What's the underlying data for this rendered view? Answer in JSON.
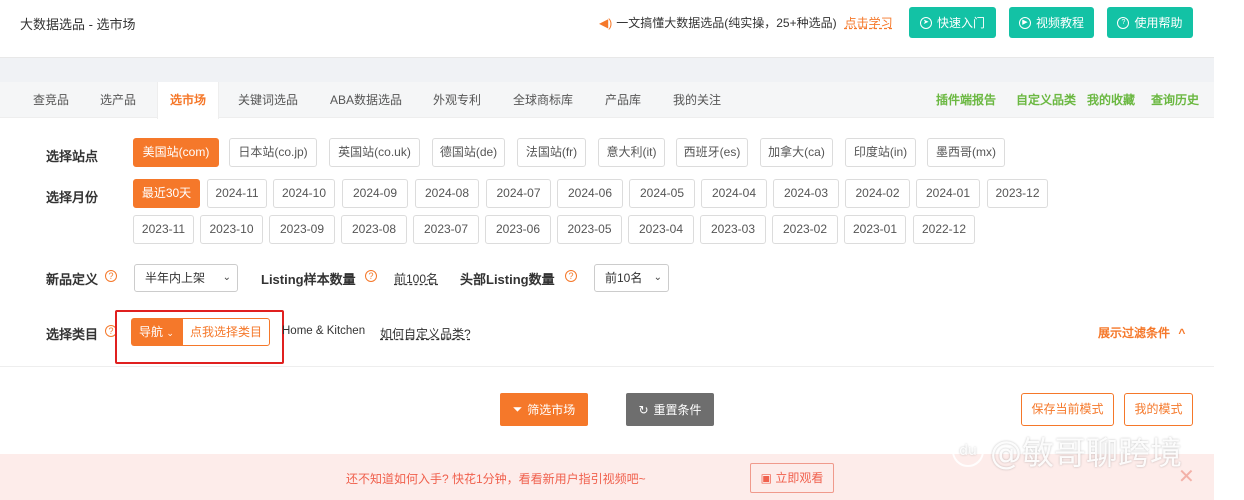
{
  "header": {
    "title": "大数据选品 - 选市场",
    "promo_text": "一文搞懂大数据选品(纯实操，25+种选品)",
    "promo_link": "点击学习",
    "buttons": [
      "快速入门",
      "视频教程",
      "使用帮助"
    ]
  },
  "tabs": [
    "查竞品",
    "选产品",
    "选市场",
    "关键词选品",
    "ABA数据选品",
    "外观专利",
    "全球商标库",
    "产品库",
    "我的关注"
  ],
  "active_tab": "选市场",
  "right_links": [
    "插件端报告",
    "自定义品类",
    "我的收藏",
    "查询历史"
  ],
  "site": {
    "label": "选择站点",
    "options": [
      "美国站(com)",
      "日本站(co.jp)",
      "英国站(co.uk)",
      "德国站(de)",
      "法国站(fr)",
      "意大利(it)",
      "西班牙(es)",
      "加拿大(ca)",
      "印度站(in)",
      "墨西哥(mx)"
    ],
    "selected": "美国站(com)"
  },
  "month": {
    "label": "选择月份",
    "row1": [
      "最近30天",
      "2024-11",
      "2024-10",
      "2024-09",
      "2024-08",
      "2024-07",
      "2024-06",
      "2024-05",
      "2024-04",
      "2024-03",
      "2024-02",
      "2024-01",
      "2023-12"
    ],
    "row2": [
      "2023-11",
      "2023-10",
      "2023-09",
      "2023-08",
      "2023-07",
      "2023-06",
      "2023-05",
      "2023-04",
      "2023-03",
      "2023-02",
      "2023-01",
      "2022-12"
    ],
    "selected": "最近30天"
  },
  "new_def": {
    "label": "新品定义",
    "value": "半年内上架",
    "listing_label": "Listing样本数量",
    "listing_value": "前100名",
    "top_label": "头部Listing数量",
    "top_value": "前10名"
  },
  "category": {
    "label": "选择类目",
    "nav_label": "导航",
    "pick_label": "点我选择类目",
    "current": "Home & Kitchen",
    "custom_link": "如何自定义品类?",
    "show_filter": "展示过滤条件"
  },
  "actions": {
    "filter": "筛选市场",
    "reset": "重置条件",
    "save": "保存当前模式",
    "mine": "我的模式"
  },
  "banner": {
    "text": "还不知道如何入手? 快花1分钟，看看新用户指引视频吧~",
    "watch": "立即观看"
  },
  "watermark": "@敏哥聊跨境",
  "colors": {
    "accent": "#f5782a",
    "teal": "#13c2a5",
    "green": "#6bb842",
    "red_box": "#e0201f"
  }
}
